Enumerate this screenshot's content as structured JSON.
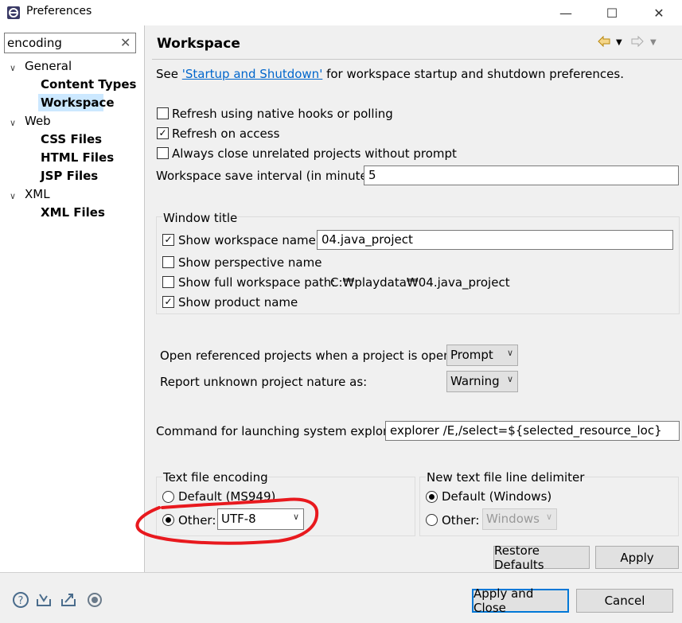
{
  "window": {
    "title": "Preferences",
    "minimize": "—",
    "maximize": "☐",
    "close": "✕"
  },
  "filter": {
    "value": "encoding",
    "clear": "✕"
  },
  "tree": [
    {
      "label": "General",
      "children": [
        "Content Types",
        "Workspace"
      ]
    },
    {
      "label": "Web",
      "children": [
        "CSS Files",
        "HTML Files",
        "JSP Files"
      ]
    },
    {
      "label": "XML",
      "children": [
        "XML Files"
      ]
    }
  ],
  "page": {
    "title": "Workspace",
    "intro_prefix": "See ",
    "intro_link": "'Startup and Shutdown'",
    "intro_suffix": " for workspace startup and shutdown preferences.",
    "refresh_native": "Refresh using native hooks or polling",
    "refresh_access": "Refresh on access",
    "always_close": "Always close unrelated projects without prompt",
    "save_interval_label": "Workspace save interval (in minutes):",
    "save_interval_value": "5",
    "window_title_group": "Window title",
    "show_workspace_name": "Show workspace name:",
    "workspace_name_value": "04.java_project",
    "show_perspective": "Show perspective name",
    "show_full_path": "Show full workspace path:",
    "full_path_value": "C:₩playdata₩04.java_project",
    "show_product": "Show product name",
    "open_ref_label": "Open referenced projects when a project is opened:",
    "open_ref_value": "Prompt",
    "report_unknown_label": "Report unknown project nature as:",
    "report_unknown_value": "Warning",
    "command_label": "Command for launching system explorer:",
    "command_value": "explorer /E,/select=${selected_resource_loc}",
    "encoding_group": "Text file encoding",
    "encoding_default": "Default (MS949)",
    "encoding_other": "Other:",
    "encoding_other_value": "UTF-8",
    "delimiter_group": "New text file line delimiter",
    "delimiter_default": "Default (Windows)",
    "delimiter_other": "Other:",
    "delimiter_other_value": "Windows",
    "restore_defaults": "Restore Defaults",
    "apply": "Apply"
  },
  "footer": {
    "apply_close": "Apply and Close",
    "cancel": "Cancel"
  },
  "checks": {
    "refresh_native": false,
    "refresh_access": true,
    "always_close": false,
    "show_workspace_name": true,
    "show_perspective": false,
    "show_full_path": false,
    "show_product": true
  },
  "colors": {
    "annotation": "#e8191e",
    "selection": "#cce8ff",
    "link": "#0066cc",
    "default_button_border": "#0078d7"
  },
  "icons": [
    "help-icon",
    "import-icon",
    "export-icon",
    "record-icon",
    "back-arrow-icon",
    "forward-arrow-icon"
  ]
}
